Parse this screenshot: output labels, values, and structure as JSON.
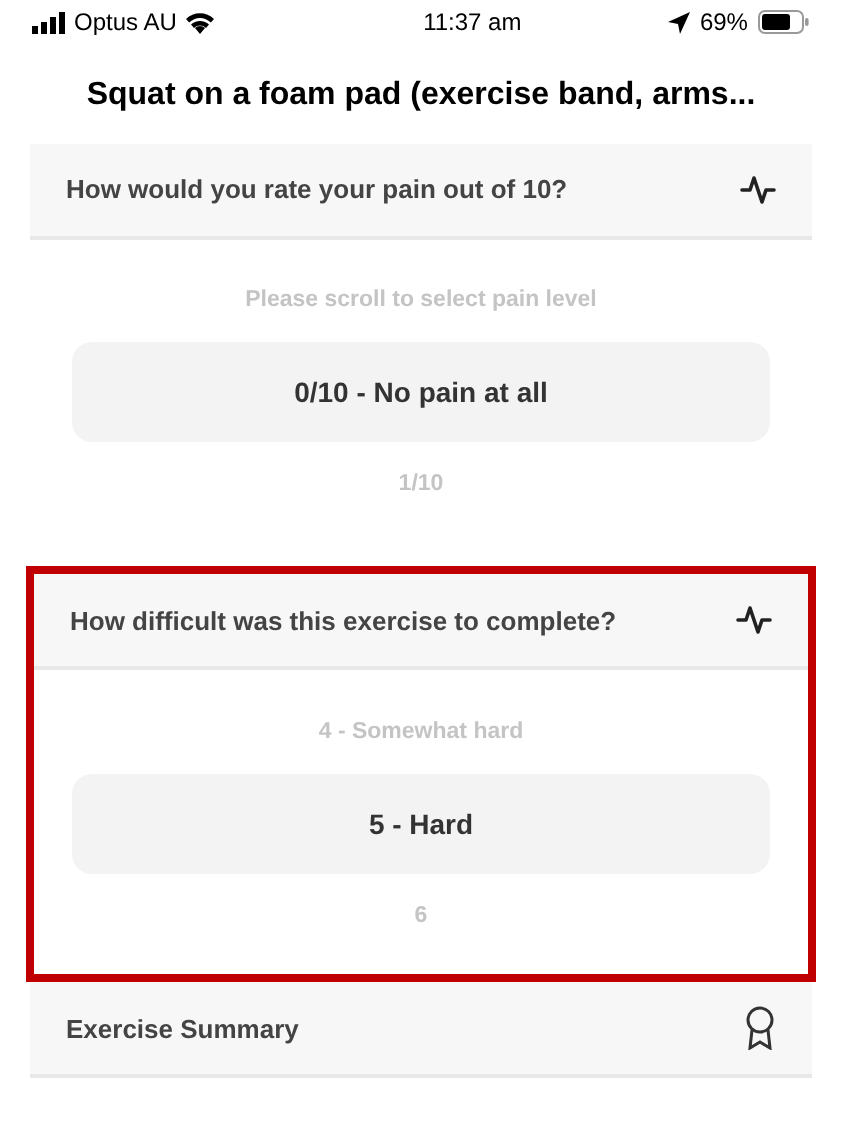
{
  "status_bar": {
    "carrier": "Optus AU",
    "time": "11:37 am",
    "battery": "69%"
  },
  "title": "Squat on a foam pad (exercise band, arms...",
  "sections": [
    {
      "kind": "question",
      "heading": "How would you rate your pain out of 10?",
      "highlighted": false,
      "hint": "Please scroll to select pain level",
      "options": [
        {
          "label": "0/10 - No pain at all",
          "selected": true
        },
        {
          "label": "1/10",
          "selected": false
        }
      ]
    },
    {
      "kind": "question",
      "heading": "How difficult was this exercise to complete?",
      "highlighted": true,
      "options": [
        {
          "label": "4 - Somewhat hard",
          "selected": false
        },
        {
          "label": "5 - Hard",
          "selected": true
        },
        {
          "label": "6",
          "selected": false
        }
      ]
    },
    {
      "kind": "summary",
      "heading": "Exercise Summary"
    }
  ]
}
